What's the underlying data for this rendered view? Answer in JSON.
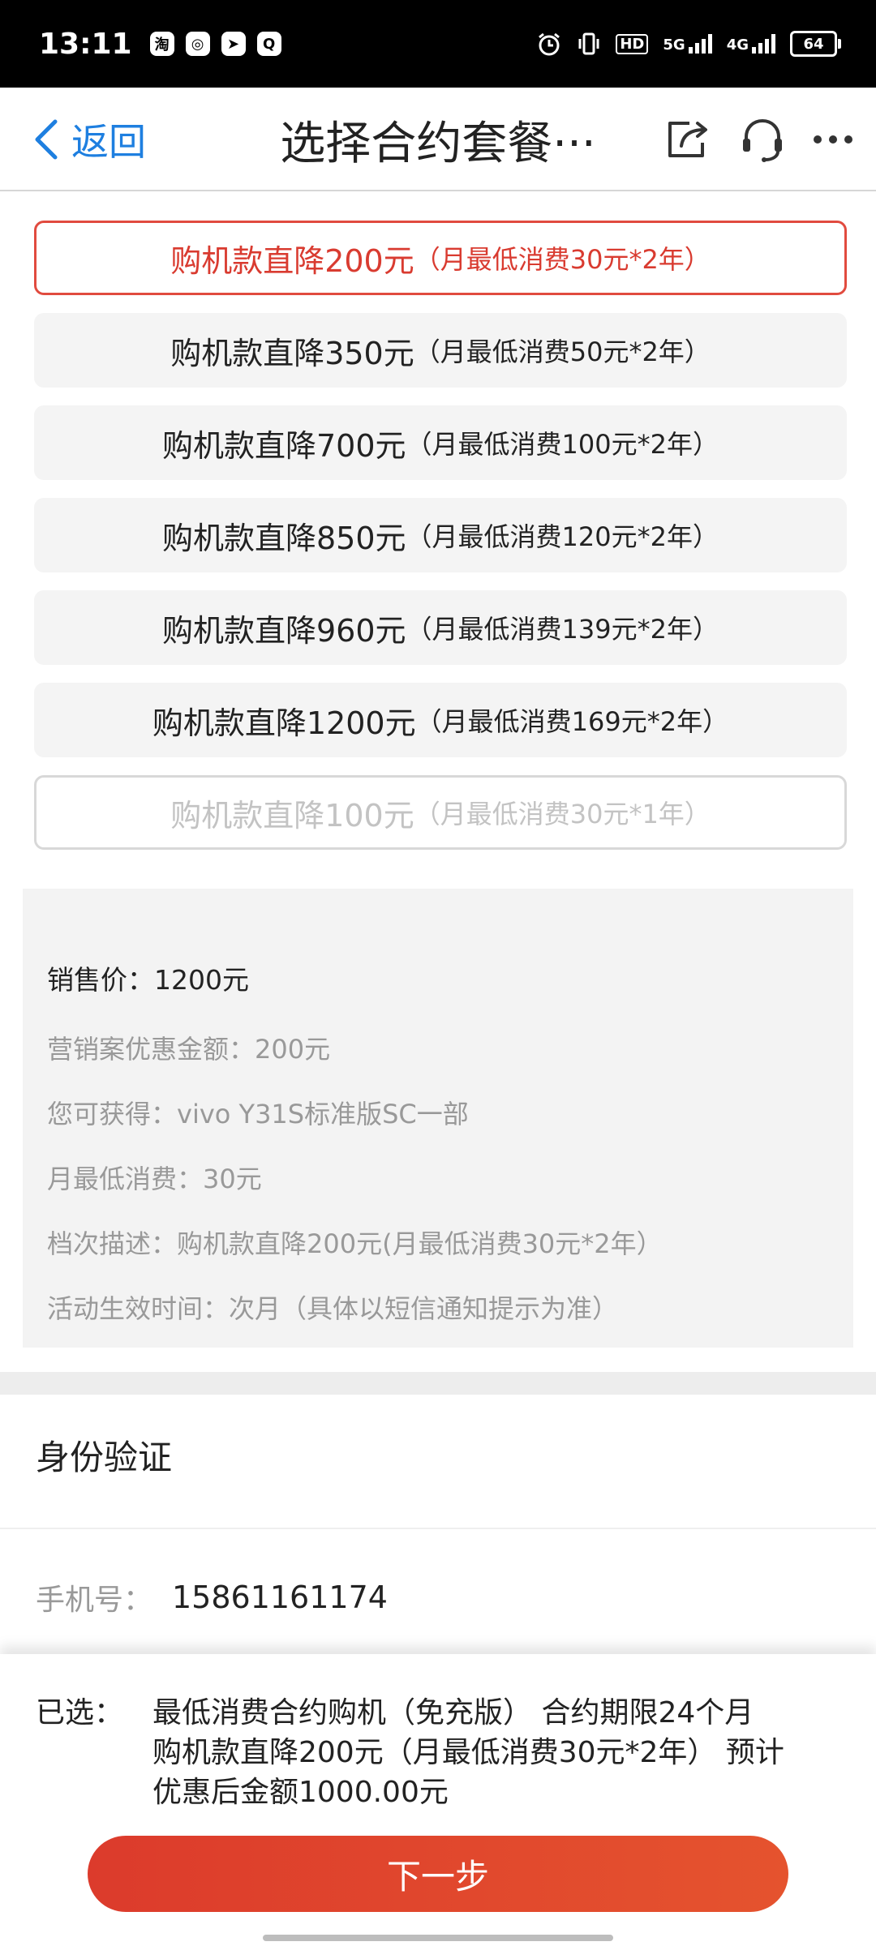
{
  "status_bar": {
    "time": "13:11",
    "notification_icons": [
      "taobao-icon",
      "app-icon",
      "app-icon",
      "app-icon"
    ],
    "hd_label": "HD",
    "net1": "5G",
    "net2": "4G",
    "battery": "64"
  },
  "nav": {
    "back_label": "返回",
    "title": "选择合约套餐···"
  },
  "options": [
    {
      "main": "购机款直降200元",
      "sub": "（月最低消费30元*2年）",
      "state": "selected"
    },
    {
      "main": "购机款直降350元",
      "sub": "（月最低消费50元*2年）",
      "state": "normal"
    },
    {
      "main": "购机款直降700元",
      "sub": "（月最低消费100元*2年）",
      "state": "normal"
    },
    {
      "main": "购机款直降850元",
      "sub": "（月最低消费120元*2年）",
      "state": "normal"
    },
    {
      "main": "购机款直降960元",
      "sub": "（月最低消费139元*2年）",
      "state": "normal"
    },
    {
      "main": "购机款直降1200元",
      "sub": "（月最低消费169元*2年）",
      "state": "normal"
    },
    {
      "main": "购机款直降100元",
      "sub": "（月最低消费30元*1年）",
      "state": "disabled"
    }
  ],
  "details": {
    "sale_price": "销售价：1200元",
    "discount": "营销案优惠金额：200元",
    "gain": "您可获得：vivo Y31S标准版SC一部",
    "min_spend": "月最低消费：30元",
    "tier_desc": "档次描述：购机款直降200元(月最低消费30元*2年）",
    "effective_time": "活动生效时间：次月（具体以短信通知提示为准）"
  },
  "identity": {
    "section_title": "身份验证",
    "phone_label": "手机号：",
    "phone_value": "15861161174"
  },
  "summary": {
    "label": "已选：",
    "line1": "最低消费合约购机（免充版） 合约期限24个月",
    "line2": "购机款直降200元（月最低消费30元*2年） 预计",
    "line3": "优惠后金额1000.00元"
  },
  "next_button": "下一步",
  "colors": {
    "accent_red": "#d93b30",
    "link_blue": "#1e7fe0"
  }
}
